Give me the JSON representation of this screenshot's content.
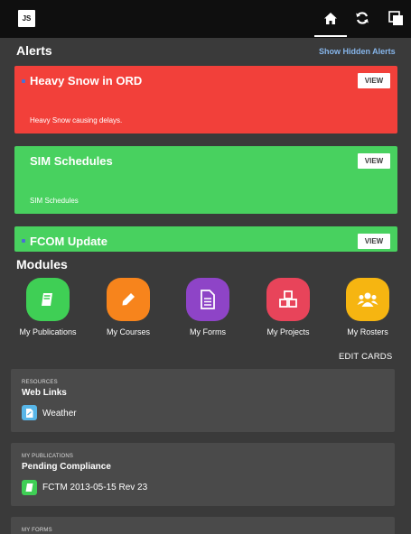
{
  "app": {
    "logo_text": "JS"
  },
  "nav": {
    "icons": [
      "home-icon",
      "sync-icon",
      "copy-icon"
    ]
  },
  "alerts_section": {
    "title": "Alerts",
    "show_hidden_label": "Show Hidden Alerts",
    "items": [
      {
        "title": "Heavy Snow in ORD",
        "body": "Heavy Snow causing delays.",
        "view_label": "VIEW",
        "color": "#f2403a"
      },
      {
        "title": "SIM Schedules",
        "body": "SIM Schedules",
        "view_label": "VIEW",
        "color": "#48d15f"
      },
      {
        "title": "FCOM Update",
        "body": "",
        "view_label": "VIEW",
        "color": "#48d15f"
      }
    ]
  },
  "modules_section": {
    "title": "Modules",
    "items": [
      {
        "label": "My Publications",
        "icon": "book-icon",
        "color": "#3fcf55"
      },
      {
        "label": "My Courses",
        "icon": "pencil-icon",
        "color": "#f7841c"
      },
      {
        "label": "My Forms",
        "icon": "document-icon",
        "color": "#8e44c7"
      },
      {
        "label": "My Projects",
        "icon": "cubes-icon",
        "color": "#e8445a"
      },
      {
        "label": "My Rosters",
        "icon": "people-icon",
        "color": "#f6b511"
      }
    ],
    "edit_cards_label": "EDIT CARDS"
  },
  "cards": [
    {
      "kicker": "RESOURCES",
      "title": "Web Links",
      "item_label": "Weather",
      "item_icon": "link-doc-icon",
      "item_color": "#58b6e8"
    },
    {
      "kicker": "MY PUBLICATIONS",
      "title": "Pending Compliance",
      "item_label": "FCTM 2013-05-15 Rev 23",
      "item_icon": "book-icon",
      "item_color": "#3fcf55"
    },
    {
      "kicker": "MY FORMS"
    }
  ]
}
